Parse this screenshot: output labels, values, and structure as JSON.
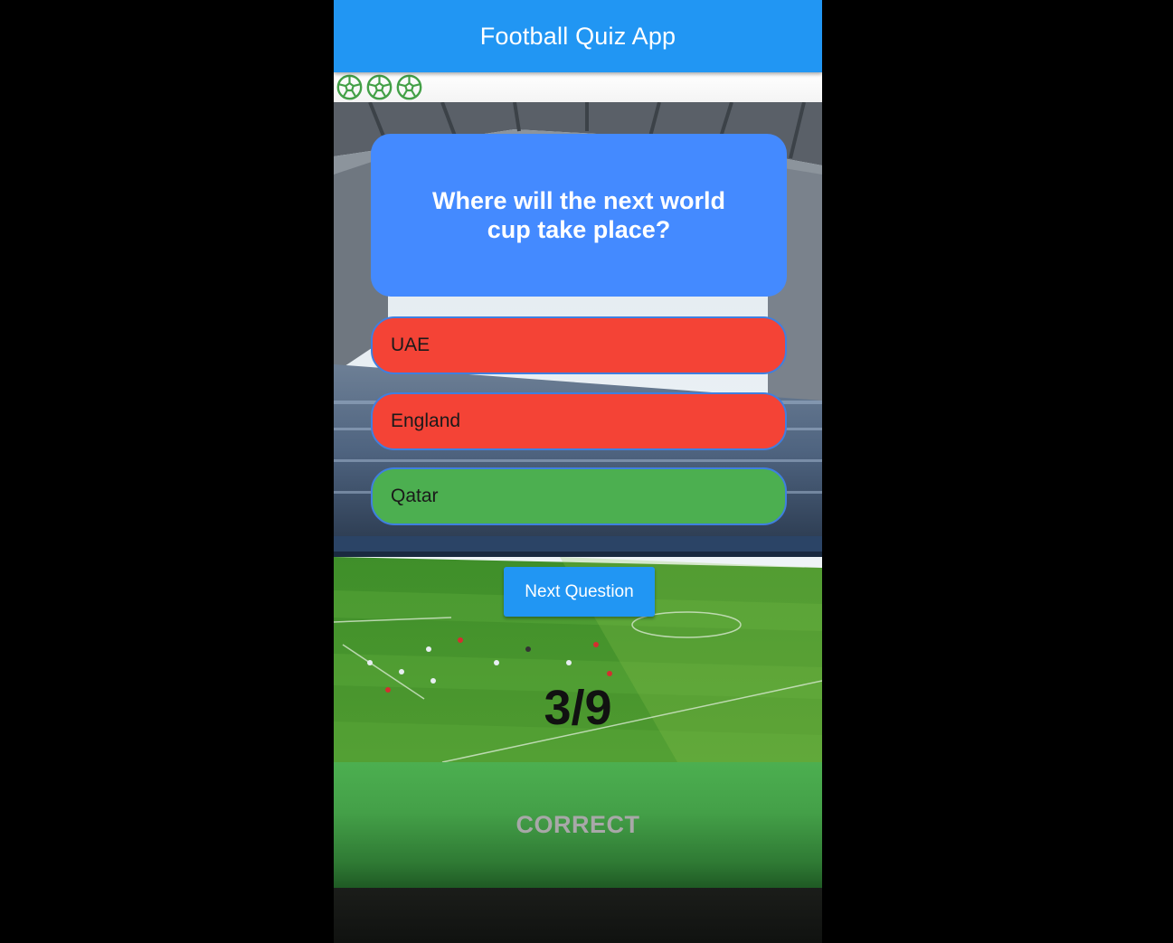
{
  "app": {
    "title": "Football Quiz App"
  },
  "score": {
    "icons": [
      "soccer-ball-icon",
      "soccer-ball-icon",
      "soccer-ball-icon"
    ],
    "icon_color": "#43a047"
  },
  "question": {
    "text": "Where will the next world cup take place?"
  },
  "answers": [
    {
      "label": "UAE",
      "state": "wrong",
      "color": "#f44336"
    },
    {
      "label": "England",
      "state": "wrong",
      "color": "#f44336"
    },
    {
      "label": "Qatar",
      "state": "correct",
      "color": "#4caf50"
    }
  ],
  "next_button": {
    "label": "Next Question"
  },
  "progress": {
    "text": "3/9"
  },
  "result": {
    "text": "CORRECT"
  },
  "colors": {
    "appbar": "#2196f3",
    "question_card": "#448aff"
  }
}
